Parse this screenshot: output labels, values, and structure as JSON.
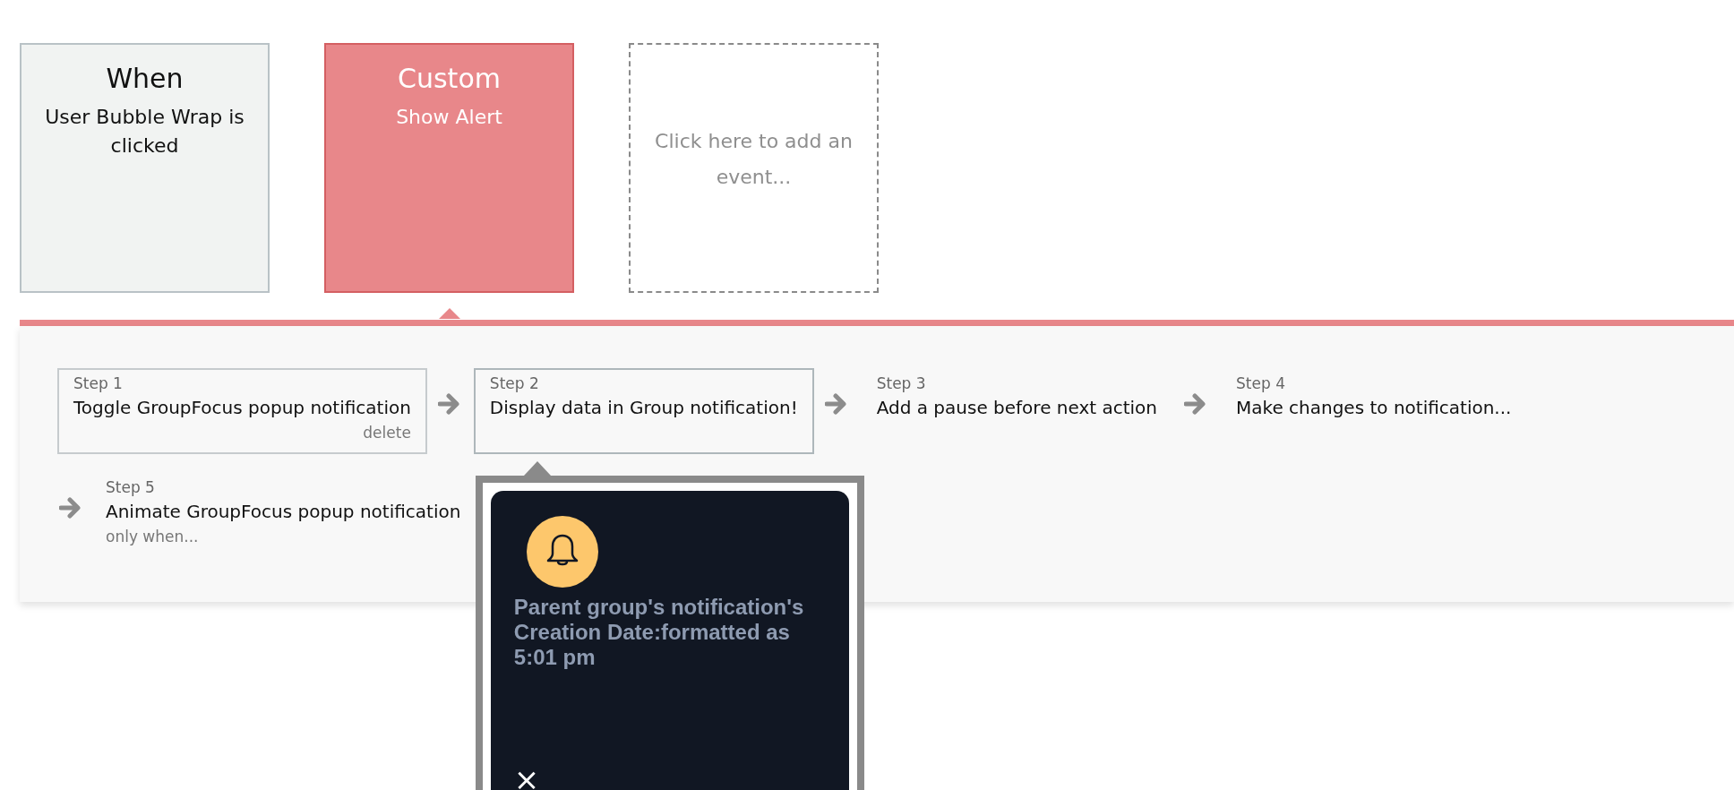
{
  "triggers": [
    {
      "kind": "when",
      "title": "When",
      "subtitle": "User Bubble Wrap is clicked",
      "selected": false
    },
    {
      "kind": "custom",
      "title": "Custom",
      "subtitle": "Show Alert",
      "selected": true
    },
    {
      "kind": "add",
      "label": "Click here to add an event..."
    }
  ],
  "steps": [
    {
      "label": "Step 1",
      "title": "Toggle GroupFocus popup notification",
      "action": "delete",
      "selected": false
    },
    {
      "label": "Step 2",
      "title": "Display data in Group notification!",
      "selected": true
    },
    {
      "label": "Step 3",
      "title": "Add a pause before next action",
      "selected": false
    },
    {
      "label": "Step 4",
      "title": "Make changes to notification...",
      "selected": false
    },
    {
      "label": "Step 5",
      "title": "Animate GroupFocus popup notification",
      "note": "only when...",
      "selected": false
    }
  ],
  "popup": {
    "message": "Parent group's notification's Creation Date:formatted as 5:01 pm",
    "close": "×"
  }
}
